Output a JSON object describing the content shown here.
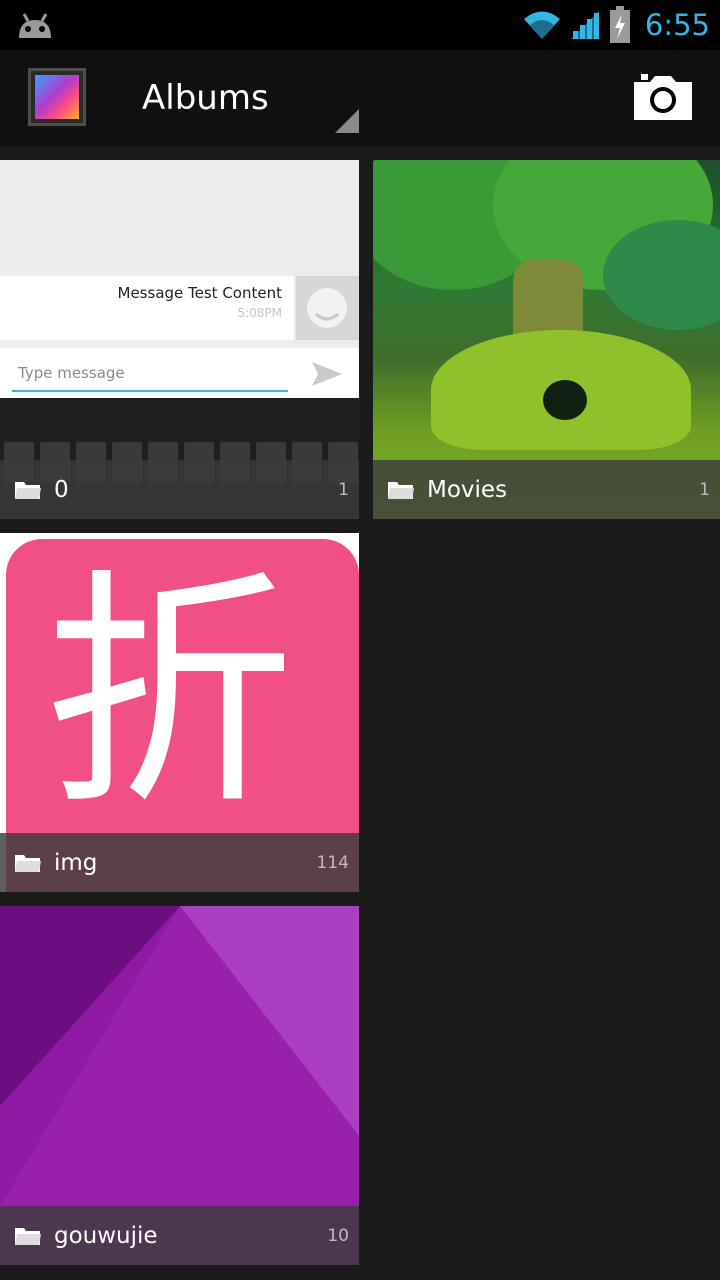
{
  "status_bar": {
    "time": "6:55",
    "icons": [
      "android-icon",
      "wifi-icon",
      "cell-signal-icon",
      "battery-charging-icon"
    ],
    "accent_color": "#33b5e5"
  },
  "action_bar": {
    "title": "Albums",
    "app_icon": "gallery-app-icon",
    "camera_icon": "camera-icon"
  },
  "albums": [
    {
      "name": "0",
      "count": "1",
      "thumbnail": {
        "message_text": "Message Test Content",
        "message_time": "5:08PM",
        "input_placeholder": "Type message"
      }
    },
    {
      "name": "Movies",
      "count": "1"
    },
    {
      "name": "img",
      "count": "114",
      "thumbnail": {
        "glyph": "折"
      }
    },
    {
      "name": "gouwujie",
      "count": "10"
    }
  ]
}
